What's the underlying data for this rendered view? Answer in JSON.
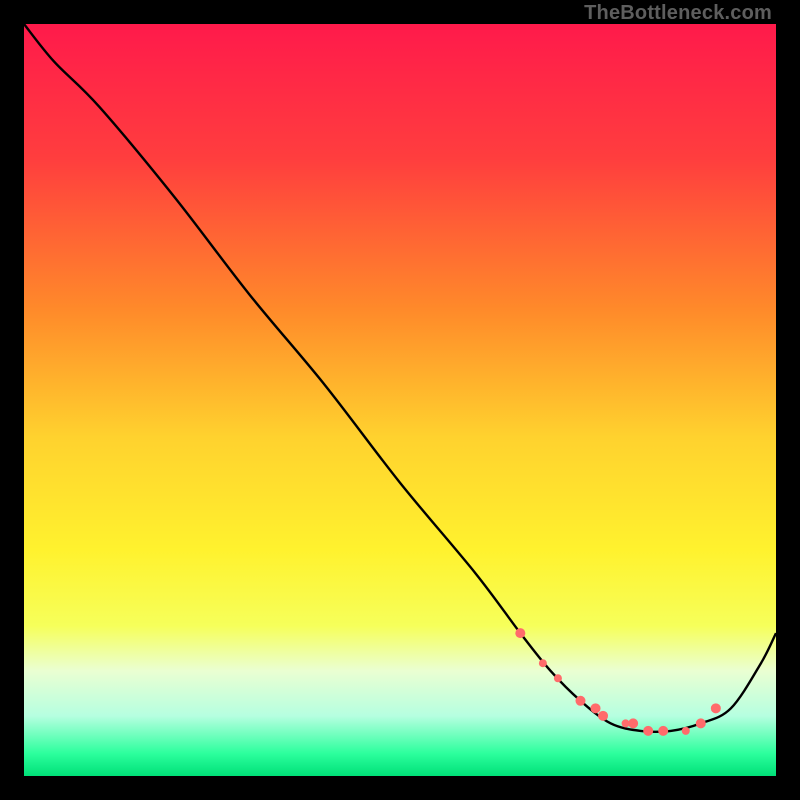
{
  "watermark": "TheBottleneck.com",
  "chart_data": {
    "type": "line",
    "title": "",
    "xlabel": "",
    "ylabel": "",
    "xlim": [
      0,
      100
    ],
    "ylim": [
      0,
      100
    ],
    "grid": false,
    "gradient_stops": [
      {
        "offset": 0,
        "color": "#ff1a4b"
      },
      {
        "offset": 18,
        "color": "#ff3e3e"
      },
      {
        "offset": 38,
        "color": "#ff8a2a"
      },
      {
        "offset": 55,
        "color": "#ffd22e"
      },
      {
        "offset": 70,
        "color": "#fff22e"
      },
      {
        "offset": 80,
        "color": "#f6ff5a"
      },
      {
        "offset": 86,
        "color": "#eaffd2"
      },
      {
        "offset": 92,
        "color": "#b6ffe0"
      },
      {
        "offset": 97,
        "color": "#2cff9d"
      },
      {
        "offset": 100,
        "color": "#00e078"
      }
    ],
    "series": [
      {
        "name": "bottleneck-curve",
        "color": "#000000",
        "x": [
          0,
          4,
          10,
          20,
          30,
          40,
          50,
          60,
          66,
          70,
          74,
          78,
          82,
          86,
          90,
          94,
          98,
          100
        ],
        "y": [
          100,
          95,
          89,
          77,
          64,
          52,
          39,
          27,
          19,
          14,
          10,
          7,
          6,
          6,
          7,
          9,
          15,
          19
        ]
      }
    ],
    "markers": {
      "name": "highlighted-points",
      "color": "#ff6b6b",
      "x": [
        66,
        69,
        71,
        74,
        76,
        77,
        80,
        81,
        83,
        85,
        88,
        90,
        92
      ],
      "y": [
        19,
        15,
        13,
        10,
        9,
        8,
        7,
        7,
        6,
        6,
        6,
        7,
        9
      ],
      "r": [
        5,
        4,
        4,
        5,
        5,
        5,
        4,
        5,
        5,
        5,
        4,
        5,
        5
      ]
    }
  }
}
